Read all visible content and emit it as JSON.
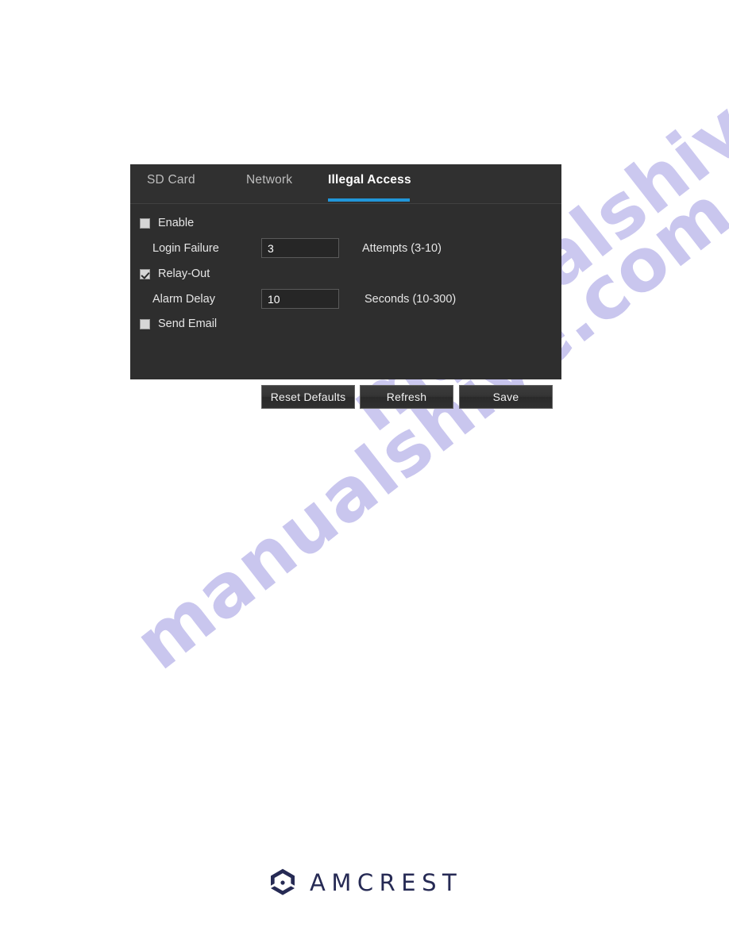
{
  "page": {
    "background_color": "#ffffff"
  },
  "watermark": {
    "text": "manualshive.com",
    "color": "#c9c6ee",
    "angle_deg": -38,
    "instances": [
      "manualshive.com",
      "manualshive.com"
    ]
  },
  "panel": {
    "name": "illegal-access-settings-panel",
    "background_color": "#2e2e2e",
    "accent_color": "#2196d9",
    "tabs": [
      {
        "id": "sd-card",
        "label": "SD Card",
        "active": false
      },
      {
        "id": "network",
        "label": "Network",
        "active": false
      },
      {
        "id": "illegal-access",
        "label": "Illegal Access",
        "active": true
      }
    ],
    "rows": {
      "enable": {
        "label": "Enable",
        "checked": false
      },
      "login_failure": {
        "label": "Login Failure",
        "value": "3",
        "placeholder": "",
        "unit": "Attempts (3-10)"
      },
      "relay_out": {
        "label": "Relay-Out",
        "checked": true
      },
      "alarm_delay": {
        "label": "Alarm Delay",
        "value": "10",
        "placeholder": "",
        "unit": "Seconds (10-300)"
      },
      "send_email": {
        "label": "Send Email",
        "checked": false
      }
    },
    "buttons": {
      "reset_defaults": "Reset Defaults",
      "refresh": "Refresh",
      "save": "Save"
    }
  },
  "footer": {
    "brand": "AMCREST",
    "brand_color": "#262a54"
  }
}
